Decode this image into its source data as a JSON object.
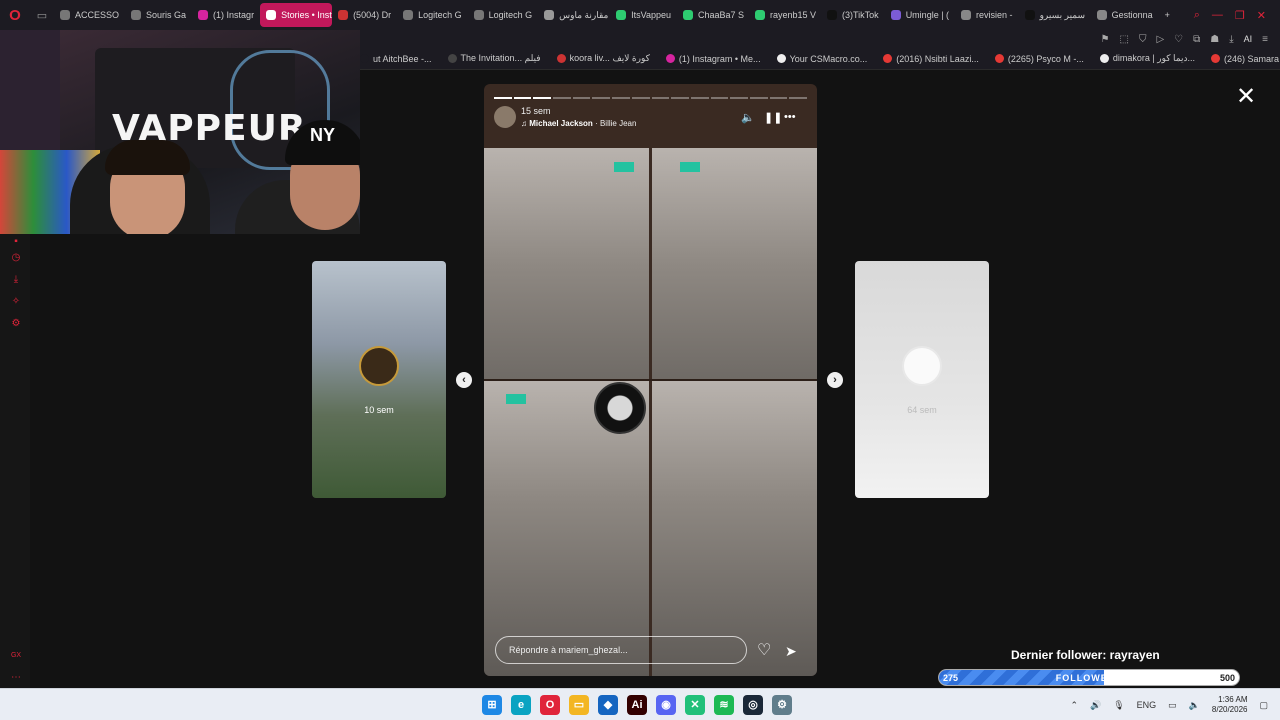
{
  "browser": {
    "tabs": [
      {
        "label": "ACCESSO",
        "fav": "#777"
      },
      {
        "label": "Souris Ga",
        "fav": "#777"
      },
      {
        "label": "(1) Instagr",
        "fav": "#d6249f"
      },
      {
        "label": "Stories • Instag",
        "fav": "#fff",
        "active": true
      },
      {
        "label": "(5004) Dr",
        "fav": "#c33"
      },
      {
        "label": "Logitech G",
        "fav": "#777"
      },
      {
        "label": "Logitech G",
        "fav": "#777"
      },
      {
        "label": "مقارنة ماوس",
        "fav": "#999"
      },
      {
        "label": "ItsVappeu",
        "fav": "#2ecc71"
      },
      {
        "label": "ChaaBa7 S",
        "fav": "#2ecc71"
      },
      {
        "label": "rayenb15 V",
        "fav": "#2ecc71"
      },
      {
        "label": "(3)TikTok",
        "fav": "#111"
      },
      {
        "label": "Umingle | (",
        "fav": "#7c5cd6"
      },
      {
        "label": "revisien -",
        "fav": "#888"
      },
      {
        "label": "سمير بسيرو",
        "fav": "#111"
      },
      {
        "label": "Gestionna",
        "fav": "#888"
      }
    ],
    "address_ai": "AI",
    "bookmarks": [
      {
        "label": "ut AitchBee -...",
        "color": "#1c1b22"
      },
      {
        "label": "The Invitation... فيلم",
        "color": "#444"
      },
      {
        "label": "koora liv... كورة لايف",
        "color": "#c33"
      },
      {
        "label": "(1) Instagram • Me...",
        "color": "#d6249f"
      },
      {
        "label": "Your CSMacro.co...",
        "color": "#eee"
      },
      {
        "label": "(2016) Nsibti Laazi...",
        "color": "#e53935"
      },
      {
        "label": "(2265) Psyco M -...",
        "color": "#e53935"
      },
      {
        "label": "dimakora | ديما كور...",
        "color": "#eee"
      },
      {
        "label": "(246) Samara - Sa...",
        "color": "#e53935"
      }
    ],
    "sidebar_icon": "GX"
  },
  "webcam": {
    "wall_text": "VAPPEUR",
    "cap_text": "NY"
  },
  "story": {
    "time": "15 sem",
    "song_title": "Michael Jackson",
    "song_artist": "· Billie Jean",
    "progress_total": 16,
    "progress_done": 3,
    "reply_placeholder": "Répondre à mariem_ghezal...",
    "icons": [
      "speaker-icon",
      "pause-icon",
      "more-icon",
      "heart-icon",
      "send-icon"
    ]
  },
  "previews": {
    "left_time": "10 sem",
    "right_time": "64 sem"
  },
  "close_label": "✕",
  "overlay": {
    "dernier_follower": "Dernier follower: rayrayen",
    "current": "275",
    "label": "FOLLOWERS",
    "goal": "500",
    "fraction": 0.55
  },
  "taskbar": {
    "icons": [
      {
        "name": "windows-start-icon",
        "glyph": "⊞",
        "bg": "#1e88e5"
      },
      {
        "name": "edge-icon",
        "glyph": "e",
        "bg": "#0aa3c2"
      },
      {
        "name": "opera-icon",
        "glyph": "O",
        "bg": "#e0243a"
      },
      {
        "name": "file-explorer-icon",
        "glyph": "▭",
        "bg": "#f3b623"
      },
      {
        "name": "shield-icon",
        "glyph": "◆",
        "bg": "#1565c0"
      },
      {
        "name": "illustrator-icon",
        "glyph": "Ai",
        "bg": "#330000"
      },
      {
        "name": "discord-icon",
        "glyph": "◉",
        "bg": "#5865f2"
      },
      {
        "name": "capcut-icon",
        "glyph": "✕",
        "bg": "#21c07a"
      },
      {
        "name": "spotify-icon",
        "glyph": "≋",
        "bg": "#1db954"
      },
      {
        "name": "steam-icon",
        "glyph": "◎",
        "bg": "#1b2838"
      },
      {
        "name": "settings-icon",
        "glyph": "⚙",
        "bg": "#607d8b"
      }
    ],
    "lang": "ENG",
    "time": "1:36 AM",
    "date": "8/20/2026"
  }
}
